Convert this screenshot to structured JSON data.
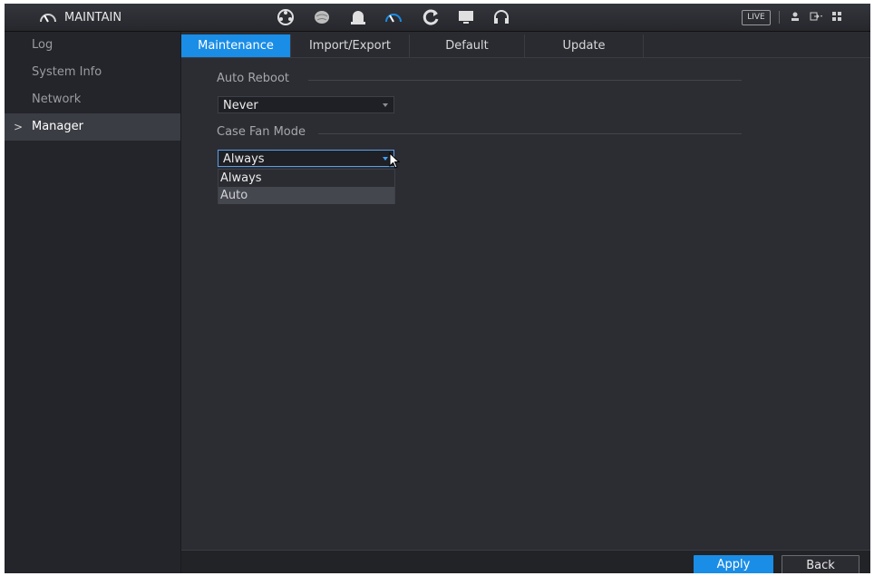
{
  "header": {
    "title": "MAINTAIN",
    "title_icon": "gauge-icon",
    "toolbar_icons": [
      "film-reel-icon",
      "brain-icon",
      "bell-icon",
      "gauge-icon",
      "refresh-icon",
      "monitor-icon",
      "headset-icon"
    ],
    "live_label": "LIVE",
    "right_icons": [
      "user-icon",
      "logout-icon",
      "grid-icon"
    ]
  },
  "sidebar": {
    "items": [
      {
        "label": "Log",
        "active": false
      },
      {
        "label": "System Info",
        "active": false
      },
      {
        "label": "Network",
        "active": false
      },
      {
        "label": "Manager",
        "active": true
      }
    ],
    "expand_indicator": ">"
  },
  "tabs": [
    {
      "label": "Maintenance",
      "active": true
    },
    {
      "label": "Import/Export",
      "active": false
    },
    {
      "label": "Default",
      "active": false
    },
    {
      "label": "Update",
      "active": false
    }
  ],
  "auto_reboot": {
    "label": "Auto Reboot",
    "value": "Never"
  },
  "case_fan_mode": {
    "label": "Case Fan Mode",
    "value": "Always",
    "options": [
      "Always",
      "Auto"
    ],
    "hovered_option": "Auto"
  },
  "footer": {
    "apply_label": "Apply",
    "back_label": "Back"
  },
  "colors": {
    "accent": "#1a8de6",
    "background": "#2c2d33",
    "sidebar": "#24252a"
  }
}
